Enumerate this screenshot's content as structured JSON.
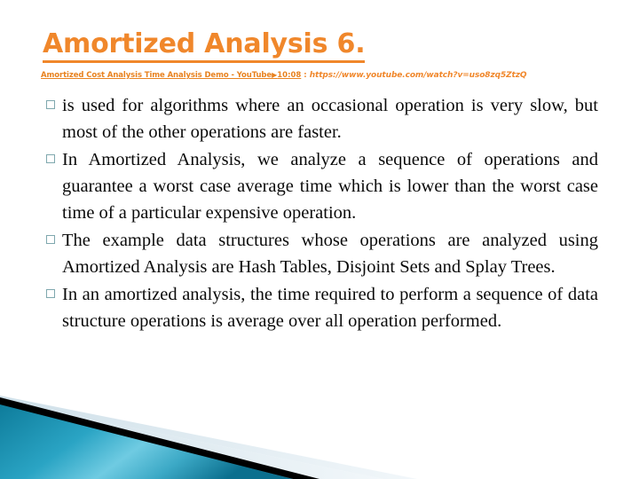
{
  "slide": {
    "title": "Amortized Analysis 6.",
    "accent_color": "#F0872B",
    "body_text_color": "#0A0A0A",
    "bullet_border_color": "#7FA8AE",
    "background_color": "#FFFFFF",
    "reference": {
      "link_title": "Amortized Cost Analysis Time Analysis Demo - YouTube",
      "play_icon": "▶",
      "duration": "10:08",
      "separator": ":",
      "url": "https://www.youtube.com/watch?v=uso8zq5ZtzQ"
    },
    "bullets": [
      {
        "marker": "hollow-square",
        "text": "is used for algorithms where an occasional operation is very slow, but most of the other operations are faster."
      },
      {
        "marker": "hollow-square",
        "text": "In Amortized Analysis, we analyze a sequence of operations and guarantee a worst case average time which is lower than the worst case time of a particular expensive operation."
      },
      {
        "marker": "hollow-square",
        "text": "The example data structures whose operations are analyzed using Amortized Analysis are Hash Tables, Disjoint Sets and Splay Trees."
      },
      {
        "marker": "hollow-square",
        "text": "In an amortized analysis, the time required to perform a sequence of data structure operations is average over all operation performed."
      }
    ],
    "decoration": {
      "name": "bottom-left-diagonal-wedges",
      "teal_dark": "#0E7C9B",
      "teal_light": "#5FC3DC",
      "black_band": "#000000",
      "pale_blue": "#DCE7ED"
    }
  }
}
